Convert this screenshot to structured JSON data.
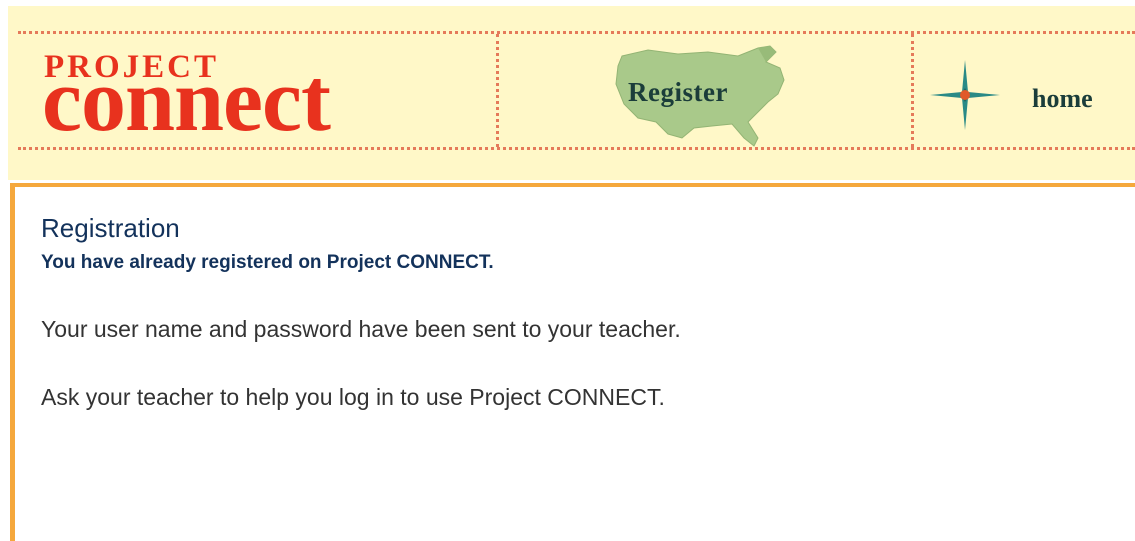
{
  "header": {
    "logo": {
      "line1": "PROJECT",
      "line2": "connect"
    },
    "nav": {
      "register_label": "Register",
      "home_label": "home"
    }
  },
  "main": {
    "title": "Registration",
    "subtitle": "You have already registered on Project CONNECT.",
    "paragraph1": "Your user name and password have been sent to your teacher.",
    "paragraph2": "Ask your teacher to help you log in to use Project CONNECT."
  },
  "colors": {
    "header_bg": "#fff8c8",
    "dotted_rule": "#e57a5a",
    "logo_red": "#e8321e",
    "nav_text": "#1b3d3a",
    "content_border": "#f5a83c",
    "heading_blue": "#13325b",
    "body_text": "#333333",
    "map_green": "#a9c98a"
  }
}
